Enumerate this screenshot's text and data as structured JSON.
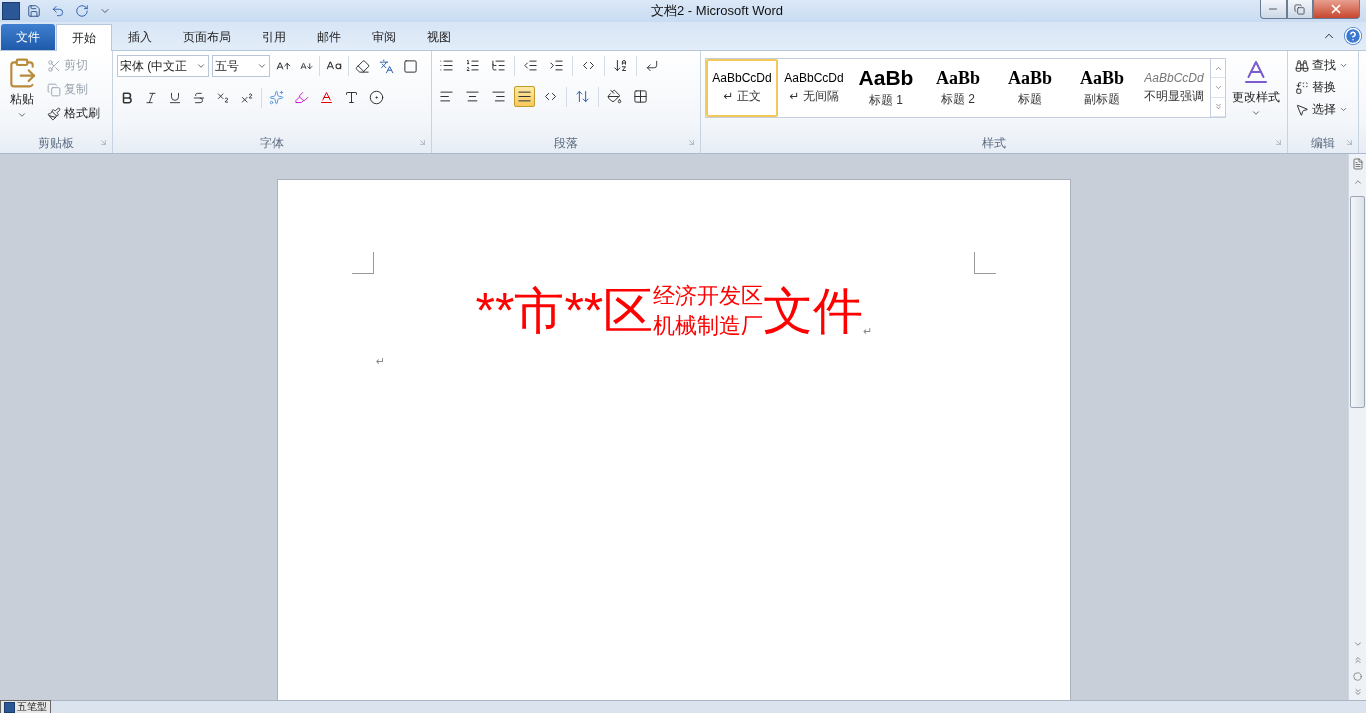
{
  "window": {
    "title": "文档2 - Microsoft Word"
  },
  "tabs": [
    {
      "label": "文件",
      "kind": "file",
      "selected": false
    },
    {
      "label": "开始",
      "kind": "tab",
      "selected": true
    },
    {
      "label": "插入",
      "kind": "tab",
      "selected": false
    },
    {
      "label": "页面布局",
      "kind": "tab",
      "selected": false
    },
    {
      "label": "引用",
      "kind": "tab",
      "selected": false
    },
    {
      "label": "邮件",
      "kind": "tab",
      "selected": false
    },
    {
      "label": "审阅",
      "kind": "tab",
      "selected": false
    },
    {
      "label": "视图",
      "kind": "tab",
      "selected": false
    }
  ],
  "clipboard": {
    "title": "剪贴板",
    "paste": "粘贴",
    "items": [
      {
        "label": "剪切",
        "disabled": true
      },
      {
        "label": "复制",
        "disabled": true
      },
      {
        "label": "格式刷",
        "disabled": false
      }
    ]
  },
  "font": {
    "title": "字体",
    "font_name": "宋体 (中文正",
    "font_size": "五号"
  },
  "paragraph": {
    "title": "段落",
    "alignment": [
      {
        "selected": false
      },
      {
        "selected": false
      },
      {
        "selected": false
      },
      {
        "selected": true
      },
      {
        "selected": false
      }
    ]
  },
  "styles": {
    "title": "样式",
    "change_styles": "更改样式",
    "items": [
      {
        "preview": "AaBbCcDd",
        "label": "正文",
        "mark": "↵",
        "kind": "normal",
        "selected": true
      },
      {
        "preview": "AaBbCcDd",
        "label": "无间隔",
        "mark": "↵",
        "kind": "no-spacing",
        "selected": false
      },
      {
        "preview": "AaBb",
        "label": "标题 1",
        "kind": "heading1",
        "selected": false
      },
      {
        "preview": "AaBb",
        "label": "标题 2",
        "kind": "heading2",
        "selected": false
      },
      {
        "preview": "AaBb",
        "label": "标题",
        "kind": "title",
        "selected": false
      },
      {
        "preview": "AaBb",
        "label": "副标题",
        "kind": "subtitle",
        "selected": false
      },
      {
        "preview": "AaBbCcDd",
        "label": "不明显强调",
        "kind": "emphasis",
        "selected": false
      }
    ]
  },
  "editing": {
    "title": "编辑",
    "items": [
      {
        "label": "查找",
        "kind": "find"
      },
      {
        "label": "替换",
        "kind": "replace"
      },
      {
        "label": "选择",
        "kind": "select"
      }
    ]
  },
  "document": {
    "lines": [
      {
        "kind": "heading",
        "left": "**市**区",
        "stack": [
          "经济开发区",
          "机械制造厂"
        ],
        "right": "文件",
        "mark": "↵"
      },
      {
        "kind": "empty",
        "mark": "↵"
      }
    ]
  },
  "ime": {
    "label": "五笔型"
  }
}
